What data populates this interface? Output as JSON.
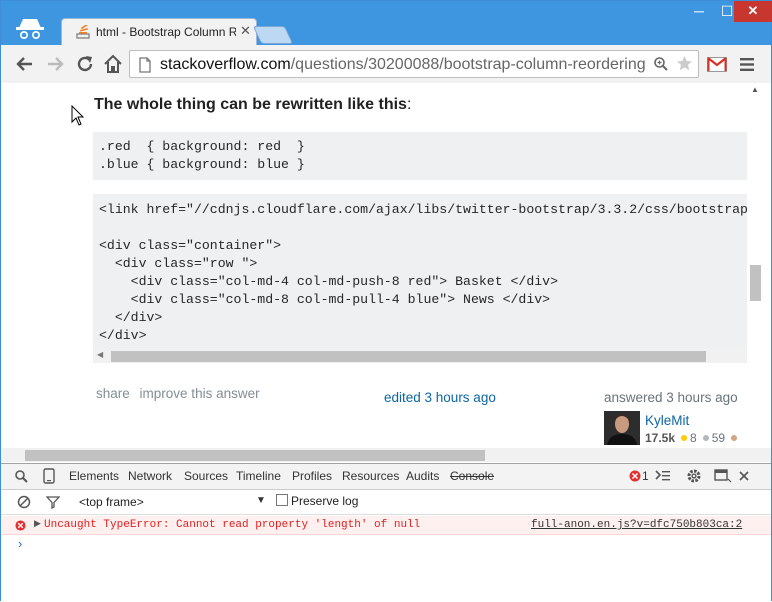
{
  "browser": {
    "tab_title": "html - Bootstrap Column R",
    "close_glyph": "✕",
    "window_min": "─",
    "window_max": "☐",
    "window_close": "✕",
    "url_host": "stackoverflow.com",
    "url_path": "/questions/30200088/bootstrap-column-reordering"
  },
  "answer": {
    "heading": "The whole thing can be rewritten like this",
    "heading_colon": ":",
    "code_css": ".red  { background: red  }\n.blue { background: blue }",
    "code_html": "<link href=\"//cdnjs.cloudflare.com/ajax/libs/twitter-bootstrap/3.3.2/css/bootstrap.\n\n<div class=\"container\">\n  <div class=\"row \">\n    <div class=\"col-md-4 col-md-push-8 red\"> Basket </div>\n    <div class=\"col-md-8 col-md-pull-4 blue\"> News </div>\n  </div>\n</div>",
    "share": "share",
    "improve": "improve this answer",
    "edited": "edited 3 hours ago",
    "answered": "answered 3 hours ago",
    "user_name": "KyleMit",
    "user_rep": "17.5k",
    "gold_count": "8",
    "silver_count": "59"
  },
  "devtools": {
    "tabs": [
      "Elements",
      "Network",
      "Sources",
      "Timeline",
      "Profiles",
      "Resources",
      "Audits",
      "Console"
    ],
    "error_count": "1",
    "frame": "<top frame>",
    "preserve_log": "Preserve log",
    "error_message": "Uncaught TypeError: Cannot read property 'length' of null",
    "error_source": "full-anon.en.js?v=dfc750b803ca:2",
    "prompt": "›"
  },
  "colors": {
    "titlebar": "#3e95e0",
    "link": "#0c65a5",
    "error": "#e02020",
    "gold": "#ffcc01",
    "silver": "#b4b8bc",
    "bronze": "#d1a684"
  }
}
